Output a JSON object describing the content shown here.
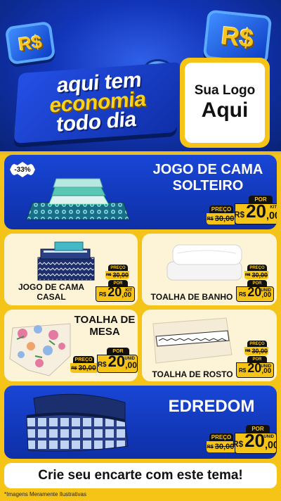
{
  "header": {
    "headline": [
      "aqui tem",
      "economia",
      "todo dia"
    ],
    "coin_text": "R$",
    "logo_line1": "Sua Logo",
    "logo_line2": "Aqui"
  },
  "products": [
    {
      "name_lines": [
        "JOGO DE CAMA",
        "SOLTEIRO"
      ],
      "discount": "-33%",
      "preco_label": "PREÇO",
      "old_prefix": "R$",
      "old_price": "30,00",
      "por_label": "POR",
      "rs": "R$",
      "new_int": "20",
      "new_dec": ",00",
      "unit": "KIT"
    },
    {
      "name_lines": [
        "JOGO DE CAMA",
        "CASAL"
      ],
      "preco_label": "PREÇO",
      "old_prefix": "R$",
      "old_price": "30,00",
      "por_label": "POR",
      "rs": "R$",
      "new_int": "20",
      "new_dec": ",00",
      "unit": "KIT"
    },
    {
      "name_lines": [
        "TOALHA DE BANHO"
      ],
      "preco_label": "PREÇO",
      "old_prefix": "R$",
      "old_price": "30,00",
      "por_label": "POR",
      "rs": "R$",
      "new_int": "20",
      "new_dec": ",00",
      "unit": "UNID"
    },
    {
      "name_lines": [
        "TOALHA DE",
        "MESA"
      ],
      "preco_label": "PREÇO",
      "old_prefix": "R$",
      "old_price": "30,00",
      "por_label": "POR",
      "rs": "R$",
      "new_int": "20",
      "new_dec": ",00",
      "unit": "UNID"
    },
    {
      "name_lines": [
        "TOALHA DE ROSTO"
      ],
      "preco_label": "PREÇO",
      "old_prefix": "R$",
      "old_price": "30,00",
      "por_label": "POR",
      "rs": "R$",
      "new_int": "20",
      "new_dec": ",00",
      "unit": "UNID"
    },
    {
      "name_lines": [
        "EDREDOM"
      ],
      "preco_label": "PREÇO",
      "old_prefix": "R$",
      "old_price": "30,00",
      "por_label": "POR",
      "rs": "R$",
      "new_int": "20",
      "new_dec": ",00",
      "unit": "UNID"
    }
  ],
  "footer": {
    "cta": "Crie seu encarte com este tema!",
    "disclaimer": "*Imagens Meramente Ilustrativas"
  },
  "colors": {
    "blue": "#1846d6",
    "yellow": "#f6c417",
    "cream": "#fdf3d6",
    "black": "#111111"
  }
}
